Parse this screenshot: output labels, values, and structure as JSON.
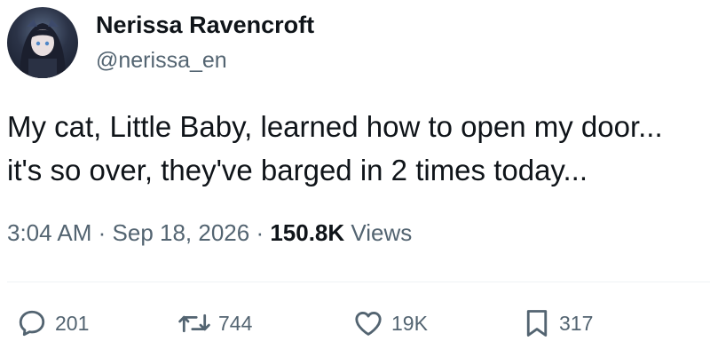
{
  "author": {
    "display_name": "Nerissa Ravencroft",
    "handle": "@nerissa_en",
    "avatar_icon": "anime-girl-avatar"
  },
  "tweet": {
    "lines": [
      "My cat, Little Baby, learned how to open my door...",
      "it's so over, they've barged in 2 times today..."
    ]
  },
  "meta": {
    "time": "3:04 AM",
    "separator": " · ",
    "date": "Sep 18, 2026",
    "views_count": "150.8K",
    "views_label": "Views"
  },
  "actions": {
    "replies": "201",
    "reposts": "744",
    "likes": "19K",
    "bookmarks": "317"
  },
  "colors": {
    "text": "#0f1419",
    "secondary": "#536471",
    "divider": "#eff3f4"
  }
}
